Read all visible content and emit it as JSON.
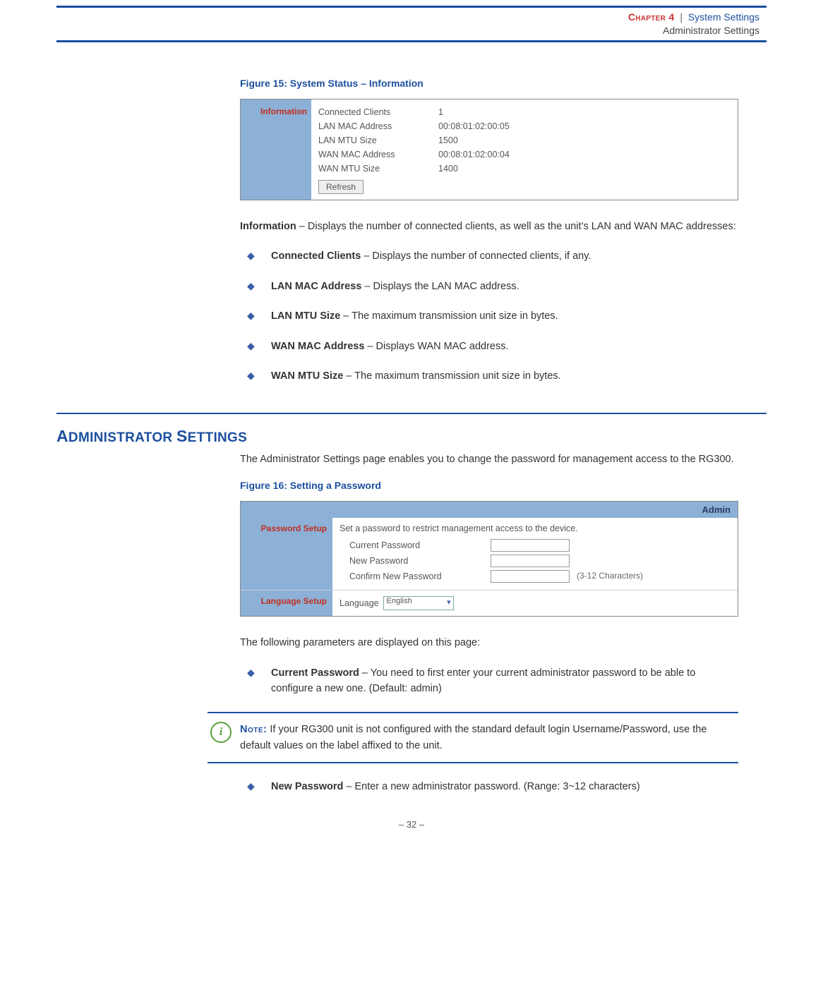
{
  "header": {
    "chapter": "Chapter 4",
    "separator": "|",
    "title": "System Settings",
    "subtitle": "Administrator Settings"
  },
  "figure15": {
    "caption": "Figure 15:  System Status – Information",
    "sidebar_label": "Information",
    "rows": [
      {
        "k": "Connected Clients",
        "v": "1"
      },
      {
        "k": "LAN MAC Address",
        "v": "00:08:01:02:00:05"
      },
      {
        "k": "LAN MTU Size",
        "v": "1500"
      },
      {
        "k": "WAN MAC Address",
        "v": "00:08:01:02:00:04"
      },
      {
        "k": "WAN MTU Size",
        "v": "1400"
      }
    ],
    "refresh_label": "Refresh"
  },
  "info_paragraph": {
    "lead_bold": "Information",
    "lead_rest": " – Displays the number of connected clients, as well as the unit’s LAN and WAN MAC addresses:"
  },
  "info_bullets": [
    {
      "b": "Connected Clients",
      "t": " – Displays the number of connected clients, if any."
    },
    {
      "b": "LAN MAC Address",
      "t": " – Displays the LAN MAC address."
    },
    {
      "b": "LAN MTU Size",
      "t": " – The maximum transmission unit size in bytes."
    },
    {
      "b": "WAN MAC Address",
      "t": " – Displays WAN MAC address."
    },
    {
      "b": "WAN MTU Size",
      "t": " – The maximum transmission unit size in bytes."
    }
  ],
  "admin_section": {
    "heading": "Administrator Settings",
    "intro": "The Administrator Settings page enables you to change the password for management access to the RG300."
  },
  "figure16": {
    "caption": "Figure 16:  Setting a Password",
    "topbar": "Admin",
    "side_pw": "Password Setup",
    "side_lang": "Language Setup",
    "description": "Set a password to restrict management access to the device.",
    "fields": {
      "current": "Current Password",
      "new": "New Password",
      "confirm": "Confirm New Password",
      "hint": "(3-12 Characters)"
    },
    "language_label": "Language",
    "language_value": "English"
  },
  "params_intro": "The following parameters are displayed on this page:",
  "param_bullet_1": {
    "b": "Current Password",
    "t": " – You need to first enter your current administrator password to be able to configure a new one. (Default: admin)"
  },
  "note": {
    "label": "Note:",
    "text": " If your RG300 unit is not configured with the standard default login Username/Password, use the default values on the label affixed to the unit."
  },
  "param_bullet_2": {
    "b": "New Password",
    "t": " – Enter a new administrator password. (Range: 3~12 characters)"
  },
  "footer": "–  32  –"
}
